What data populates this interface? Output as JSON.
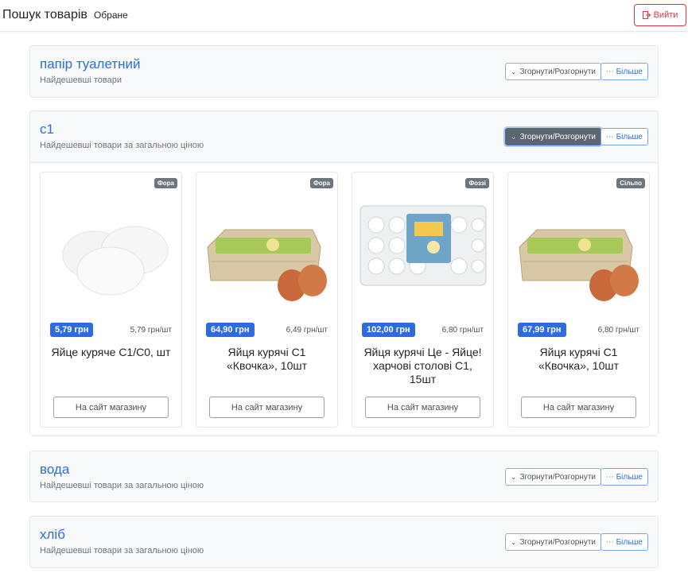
{
  "header": {
    "brand": "Пошук товарів",
    "favorites": "Обране",
    "logout": "Вийти"
  },
  "colors": {
    "accent": "#2c6be0",
    "danger": "#dc3545",
    "badge": "#6c757d"
  },
  "sections": [
    {
      "title": "папір туалетний",
      "subtitle": "Найдешевші товари",
      "toggle": "Згорнути/Розгорнути",
      "more": "Більше"
    },
    {
      "title": "с1",
      "subtitle": "Найдешевші товари за загальною ціною",
      "toggle": "Згорнути/Розгорнути",
      "more": "Більше",
      "products": [
        {
          "store": "Фора",
          "price": "5,79 грн",
          "unit": "5,79 грн/шт",
          "name": "Яйце куряче С1/С0, шт",
          "link": "На сайт магазину",
          "image": "eggs-loose"
        },
        {
          "store": "Фора",
          "price": "64,90 грн",
          "unit": "6,49 грн/шт",
          "name": "Яйця курячі С1 «Квочка», 10шт",
          "link": "На сайт магазину",
          "image": "egg-carton-brown"
        },
        {
          "store": "Фоззі",
          "price": "102,00 грн",
          "unit": "6,80 грн/шт",
          "name": "Яйця курячі Це - Яйце! харчові столові С1, 15шт",
          "link": "На сайт магазину",
          "image": "egg-tray-white"
        },
        {
          "store": "Сільпо",
          "price": "67,99 грн",
          "unit": "6,80 грн/шт",
          "name": "Яйця курячі С1 «Квочка», 10шт",
          "link": "На сайт магазину",
          "image": "egg-carton-brown"
        }
      ]
    },
    {
      "title": "вода",
      "subtitle": "Найдешевші товари за загальною ціною",
      "toggle": "Згорнути/Розгорнути",
      "more": "Більше"
    },
    {
      "title": "хліб",
      "subtitle": "Найдешевші товари за загальною ціною",
      "toggle": "Згорнути/Розгорнути",
      "more": "Більше"
    }
  ]
}
